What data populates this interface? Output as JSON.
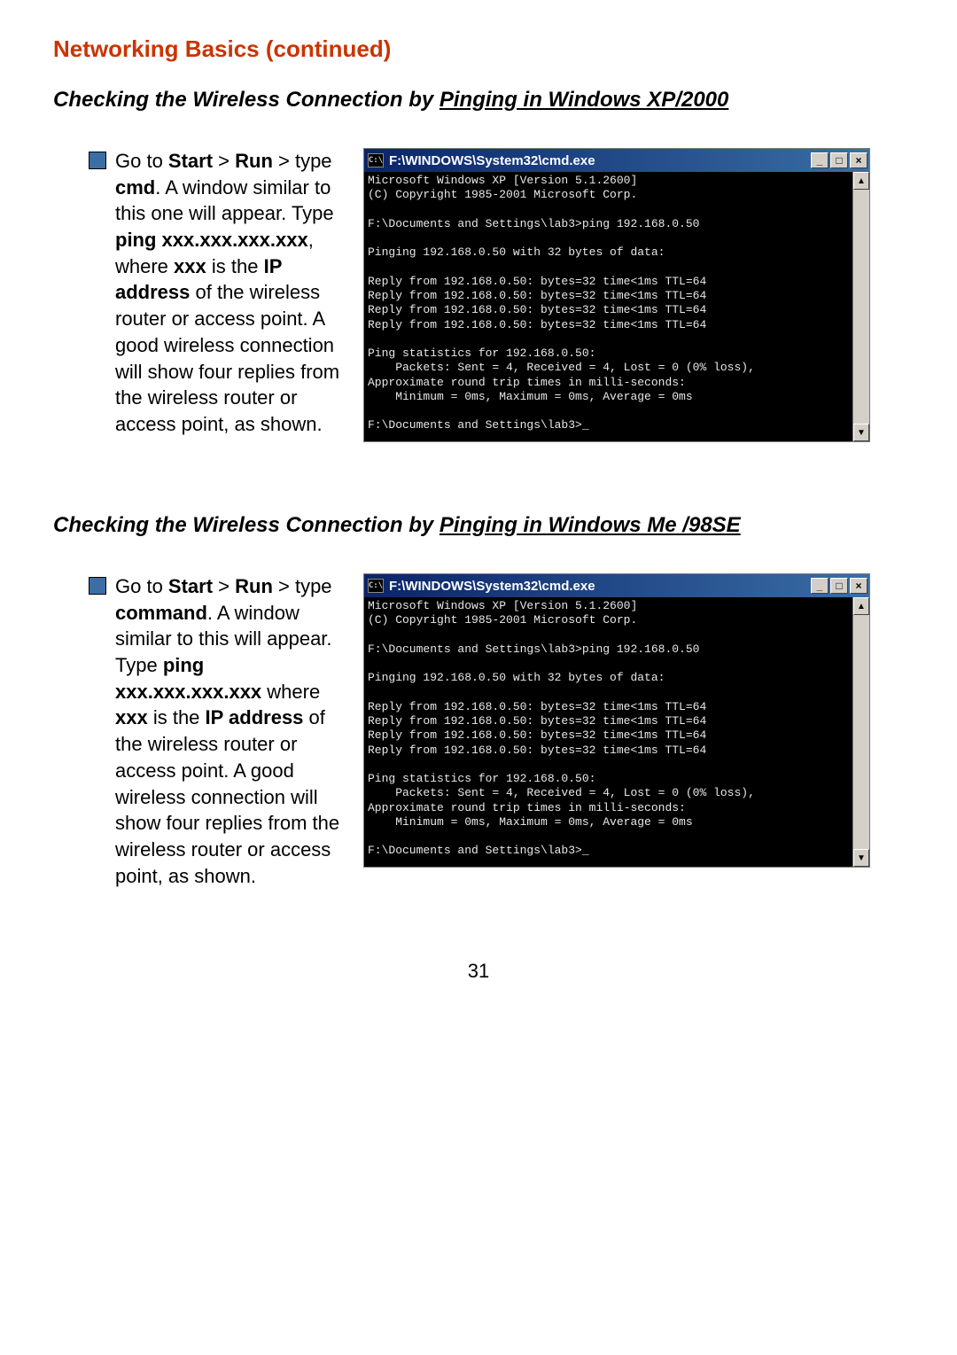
{
  "section_title": "Networking Basics (continued)",
  "heading1_plain": "Checking the Wireless Connection by ",
  "heading1_underline": "Pinging in Windows XP/2000",
  "heading2_plain": "Checking the Wireless Connection by ",
  "heading2_underline": "Pinging in Windows Me /98SE",
  "instr1_segments": {
    "s1": "Go to ",
    "b1": "Start",
    "s2": " > ",
    "b2": "Run",
    "s3": " > type ",
    "b3": "cmd",
    "s4": ".  A window similar to this one will appear.  Type ",
    "b4": "ping xxx.xxx.xxx.xxx",
    "s5": ", where ",
    "b5": "xxx",
    "s6": " is the ",
    "b6": "IP address",
    "s7": " of the wireless router or access point. A good wireless connection will show four replies from the wireless router or access point, as shown."
  },
  "instr2_segments": {
    "s1": "Go to ",
    "b1": "Start",
    "s2": " > ",
    "b2": "Run",
    "s3": " > type ",
    "b3": "command",
    "s4": ".  A window similar to this will appear.  Type ",
    "b4": "ping xxx.xxx.xxx.xxx",
    "s5": " where ",
    "b5": "xxx",
    "s6": " is the ",
    "b6": "IP address",
    "s7": " of the wireless router or access point.  A good wireless connection will show four replies from the wireless router or access point, as shown."
  },
  "cmd_window": {
    "icon_text": "C:\\",
    "title": "F:\\WINDOWS\\System32\\cmd.exe",
    "btn_min": "_",
    "btn_max": "□",
    "btn_close": "×",
    "scroll_up": "▲",
    "scroll_down": "▼"
  },
  "terminal_lines": [
    "Microsoft Windows XP [Version 5.1.2600]",
    "(C) Copyright 1985-2001 Microsoft Corp.",
    "",
    "F:\\Documents and Settings\\lab3>ping 192.168.0.50",
    "",
    "Pinging 192.168.0.50 with 32 bytes of data:",
    "",
    "Reply from 192.168.0.50: bytes=32 time<1ms TTL=64",
    "Reply from 192.168.0.50: bytes=32 time<1ms TTL=64",
    "Reply from 192.168.0.50: bytes=32 time<1ms TTL=64",
    "Reply from 192.168.0.50: bytes=32 time<1ms TTL=64",
    "",
    "Ping statistics for 192.168.0.50:",
    "    Packets: Sent = 4, Received = 4, Lost = 0 (0% loss),",
    "Approximate round trip times in milli-seconds:",
    "    Minimum = 0ms, Maximum = 0ms, Average = 0ms",
    "",
    "F:\\Documents and Settings\\lab3>_"
  ],
  "page_number": "31"
}
